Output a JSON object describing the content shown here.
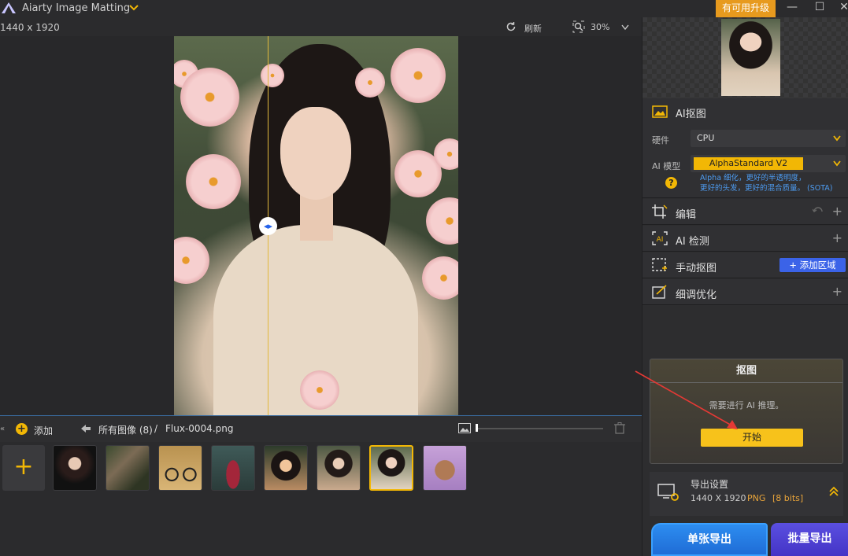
{
  "app": {
    "title": "Aiarty Image Matting",
    "upgrade_label": "有可用升级",
    "minimize": "—",
    "maximize": "☐",
    "close": "✕"
  },
  "toolbar": {
    "dimensions": "1440 x 1920",
    "refresh_label": "刷新",
    "zoom_label": "30%"
  },
  "filmstrip": {
    "add_label": "添加",
    "crumb_all": "所有图像 (8)",
    "crumb_sep": "/",
    "current_file": "Flux-0004.png",
    "size_slider_value": 0.0,
    "add_tile": "+"
  },
  "panel": {
    "ai_matting": {
      "title": "AI抠图",
      "hardware_label": "硬件",
      "hardware_value": "CPU",
      "model_label": "AI 模型",
      "model_value": "AlphaStandard  V2",
      "help": "?",
      "model_desc_line1": "Alpha 细化，更好的半透明度，",
      "model_desc_line2": "更好的头发，更好的混合质量。 (SOTA)"
    },
    "edit": {
      "title": "编辑",
      "plus": "+"
    },
    "ai_detect": {
      "title": "AI 检测",
      "plus": "+"
    },
    "manual": {
      "title": "手动抠图",
      "add_region": "+ 添加区域"
    },
    "refine": {
      "title": "细调优化",
      "plus": "+"
    },
    "matte_card": {
      "title": "抠图",
      "message": "需要进行 AI 推理。",
      "start_label": "开始"
    },
    "export": {
      "title": "导出设置",
      "dimensions": "1440 X 1920",
      "format": "PNG",
      "bits": "[8 bits]"
    },
    "single_export": "单张导出",
    "batch_export": "批量导出"
  },
  "colors": {
    "accent": "#f2b705",
    "blue": "#2d8df0",
    "purple": "#4f40d4",
    "upgrade": "#e79a1e"
  }
}
